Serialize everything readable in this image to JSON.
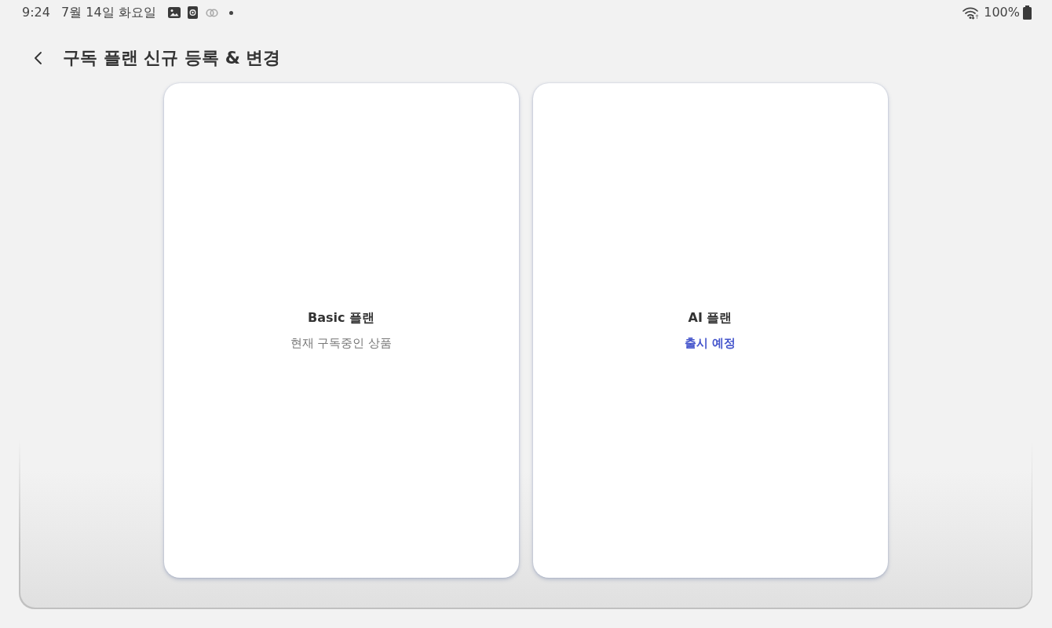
{
  "status_bar": {
    "time": "9:24",
    "date": "7월 14일 화요일",
    "battery": "100%"
  },
  "header": {
    "title": "구독 플랜 신규 등록 & 변경"
  },
  "plans": [
    {
      "kind": "current",
      "name": "Basic 플랜",
      "status": "현재 구독중인 상품"
    },
    {
      "kind": "upcoming",
      "name": "AI 플랜",
      "status": "출시 예정"
    }
  ]
}
